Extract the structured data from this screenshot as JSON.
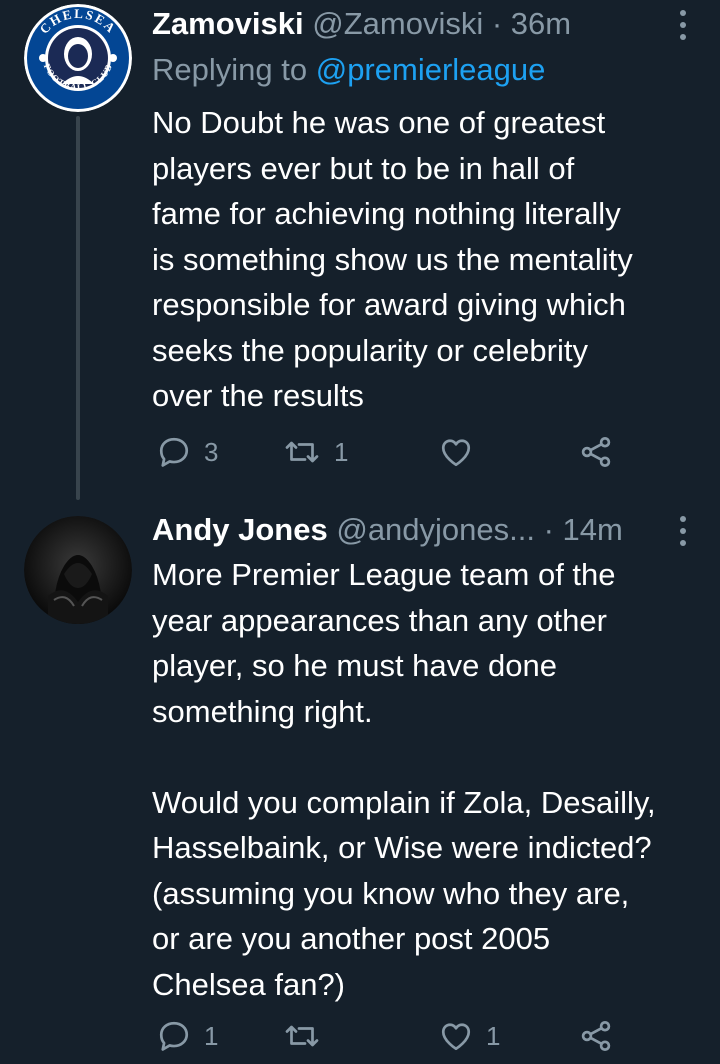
{
  "colors": {
    "background": "#15202b",
    "text_primary": "#ffffff",
    "text_secondary": "#8899a6",
    "link": "#1da1f2",
    "thread_line": "#38444d"
  },
  "tweets": [
    {
      "display_name": "Zamoviski",
      "handle_time": "@Zamoviski · 36m",
      "replying_prefix": "Replying to",
      "replying_mention": "@premierleague",
      "avatar": "chelsea-crest-avatar",
      "avatar_text_top": "CHELSEA",
      "avatar_text_bottom": "FOOTBALL CLUB",
      "text": "No Doubt he was one of greatest\nplayers ever but to be in hall of\nfame for achieving nothing literally\nis something show us the mentality\nresponsible for award giving which\nseeks the popularity or celebrity\nover the results",
      "reply_count": "3",
      "retweet_count": "1",
      "like_count": ""
    },
    {
      "display_name": "Andy Jones",
      "handle_time": "@andyjones... · 14m",
      "avatar": "hooded-figure-avatar",
      "text": "More Premier League team of the\nyear appearances than any other\nplayer, so he must have done\nsomething right.\n\nWould you complain if Zola, Desailly,\nHasselbaink, or Wise were indicted?\n(assuming you know who they are,\nor are you another post 2005\nChelsea fan?)",
      "reply_count": "1",
      "retweet_count": "",
      "like_count": "1"
    }
  ],
  "icons": {
    "reply": "reply-icon",
    "retweet": "retweet-icon",
    "like": "heart-icon",
    "share": "share-icon",
    "more": "more-icon"
  }
}
